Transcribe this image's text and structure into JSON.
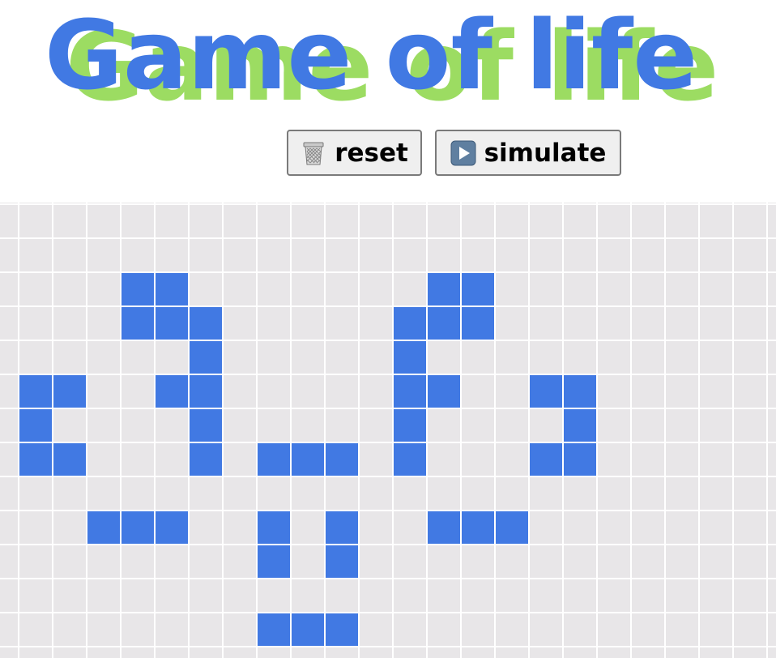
{
  "title": {
    "text": "Game of life",
    "fill_color": "#4179E3",
    "shadow_color": "#9CDC62"
  },
  "toolbar": {
    "reset": {
      "label": "reset",
      "icon": "trash-can-icon"
    },
    "simulate": {
      "label": "simulate",
      "icon": "play-button-icon"
    }
  },
  "board": {
    "dead_color": "#E8E6E8",
    "alive_color": "#4179E3",
    "grid_line_color": "#FFFFFF",
    "visible_columns": 23,
    "visible_rows": 14,
    "alive_cells": [
      [
        2,
        3
      ],
      [
        2,
        4
      ],
      [
        3,
        3
      ],
      [
        3,
        4
      ],
      [
        3,
        5
      ],
      [
        4,
        5
      ],
      [
        5,
        0
      ],
      [
        5,
        1
      ],
      [
        5,
        4
      ],
      [
        5,
        5
      ],
      [
        6,
        0
      ],
      [
        6,
        5
      ],
      [
        7,
        0
      ],
      [
        7,
        1
      ],
      [
        7,
        5
      ],
      [
        9,
        2
      ],
      [
        9,
        3
      ],
      [
        9,
        4
      ],
      [
        2,
        12
      ],
      [
        2,
        13
      ],
      [
        3,
        11
      ],
      [
        3,
        12
      ],
      [
        3,
        13
      ],
      [
        4,
        11
      ],
      [
        5,
        11
      ],
      [
        5,
        12
      ],
      [
        5,
        15
      ],
      [
        5,
        16
      ],
      [
        6,
        11
      ],
      [
        6,
        16
      ],
      [
        7,
        11
      ],
      [
        7,
        15
      ],
      [
        7,
        16
      ],
      [
        9,
        12
      ],
      [
        9,
        13
      ],
      [
        9,
        14
      ],
      [
        7,
        7
      ],
      [
        7,
        8
      ],
      [
        7,
        9
      ],
      [
        9,
        7
      ],
      [
        9,
        9
      ],
      [
        10,
        7
      ],
      [
        10,
        9
      ],
      [
        12,
        7
      ],
      [
        12,
        8
      ],
      [
        12,
        9
      ]
    ]
  }
}
